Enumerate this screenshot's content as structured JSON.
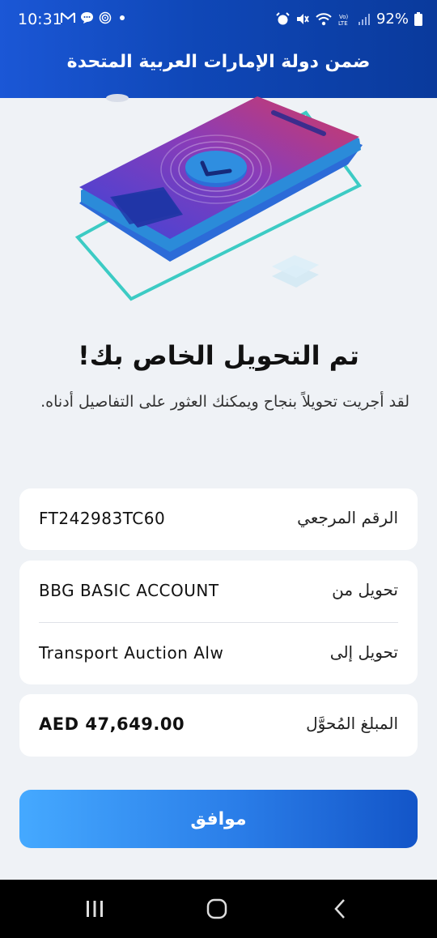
{
  "status_bar": {
    "time": "10:31",
    "battery": "92%"
  },
  "header": {
    "title": "ضمن دولة الإمارات العربية المتحدة"
  },
  "success": {
    "heading": "تم التحويل الخاص بك!",
    "message": "لقد أجريت تحويلاً بنجاح ويمكنك العثور على التفاصيل أدناه."
  },
  "details": {
    "reference": {
      "label": "الرقم المرجعي",
      "value": "FT242983TC60"
    },
    "from": {
      "label": "تحويل من",
      "value": "BBG BASIC ACCOUNT"
    },
    "to": {
      "label": "تحويل إلى",
      "value": "Transport Auction Alw"
    },
    "amount": {
      "label": "المبلغ المُحوَّل",
      "value": "AED 47,649.00"
    }
  },
  "actions": {
    "ok_label": "موافق"
  },
  "colors": {
    "header": "#0f47b7",
    "button_start": "#45a9ff",
    "button_end": "#1355c8",
    "background": "#eff2f6"
  },
  "icons": [
    "gmail-icon",
    "messages-icon",
    "fingerprint-icon",
    "alarm-icon",
    "mute-icon",
    "wifi-icon",
    "volte-icon",
    "signal-icon",
    "battery-icon",
    "recent-apps-icon",
    "home-icon",
    "back-icon"
  ]
}
